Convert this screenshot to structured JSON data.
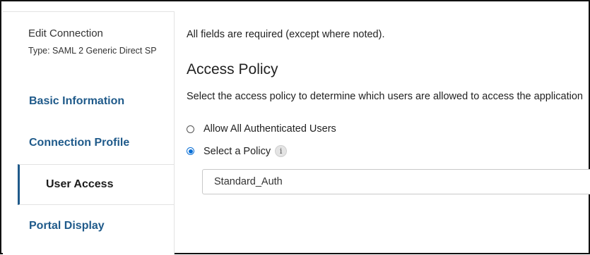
{
  "sidebar": {
    "title": "Edit Connection",
    "type_line": "Type: SAML 2 Generic Direct SP",
    "items": [
      {
        "label": "Basic Information"
      },
      {
        "label": "Connection Profile"
      },
      {
        "label": "User Access"
      },
      {
        "label": "Portal Display"
      }
    ]
  },
  "main": {
    "required_note": "All fields are required (except where noted).",
    "section_title": "Access Policy",
    "description": "Select the access policy to determine which users are allowed to access the application",
    "options": [
      {
        "label": "Allow All Authenticated Users",
        "selected": false
      },
      {
        "label": "Select a Policy",
        "selected": true
      }
    ],
    "info_glyph": "i",
    "policy_value": "Standard_Auth"
  },
  "colors": {
    "nav_link": "#1f5a8a",
    "radio_selected": "#0a6fd6",
    "frame_border": "#111111"
  },
  "icons": {
    "info": "info-icon"
  }
}
